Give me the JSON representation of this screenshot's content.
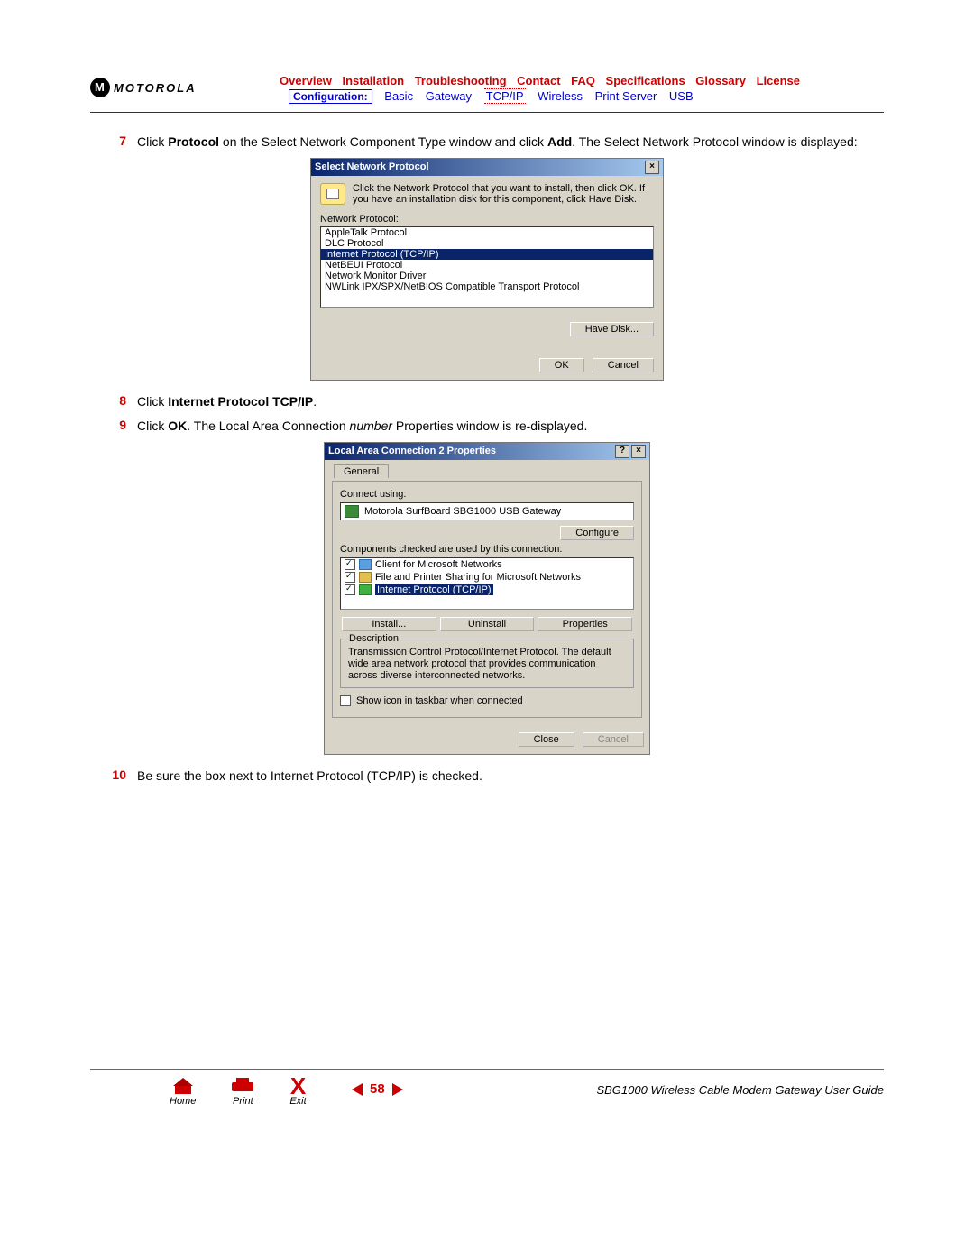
{
  "header": {
    "brand": "MOTOROLA",
    "nav_top": [
      "Overview",
      "Installation",
      "Troubleshooting",
      "Contact",
      "FAQ",
      "Specifications",
      "Glossary",
      "License"
    ],
    "nav_sub_label": "Configuration:",
    "nav_sub": [
      "Basic",
      "Gateway",
      "TCP/IP",
      "Wireless",
      "Print Server",
      "USB"
    ]
  },
  "steps": {
    "s7_num": "7",
    "s7_a": "Click ",
    "s7_b": "Protocol",
    "s7_c": " on the Select Network Component Type window and click ",
    "s7_d": "Add",
    "s7_e": ". The Select Network Protocol window is displayed:",
    "s8_num": "8",
    "s8_a": "Click ",
    "s8_b": "Internet Protocol TCP/IP",
    "s8_c": ".",
    "s9_num": "9",
    "s9_a": "Click ",
    "s9_b": "OK",
    "s9_c": ". The Local Area Connection ",
    "s9_d": "number",
    "s9_e": " Properties window is re-displayed.",
    "s10_num": "10",
    "s10_text": "Be sure the box next to Internet Protocol (TCP/IP) is checked."
  },
  "dialog1": {
    "title": "Select Network Protocol",
    "desc": "Click the Network Protocol that you want to install, then click OK. If you have an installation disk for this component, click Have Disk.",
    "list_label": "Network Protocol:",
    "items": [
      "AppleTalk Protocol",
      "DLC Protocol",
      "Internet Protocol (TCP/IP)",
      "NetBEUI Protocol",
      "Network Monitor Driver",
      "NWLink IPX/SPX/NetBIOS Compatible Transport Protocol"
    ],
    "btn_havedisk": "Have Disk...",
    "btn_ok": "OK",
    "btn_cancel": "Cancel",
    "close": "×"
  },
  "dialog2": {
    "title": "Local Area Connection 2 Properties",
    "tab": "General",
    "connect_label": "Connect using:",
    "adapter": "Motorola SurfBoard SBG1000 USB Gateway",
    "btn_configure": "Configure",
    "components_label": "Components checked are used by this connection:",
    "comp1": "Client for Microsoft Networks",
    "comp2": "File and Printer Sharing for Microsoft Networks",
    "comp3": "Internet Protocol (TCP/IP)",
    "btn_install": "Install...",
    "btn_uninstall": "Uninstall",
    "btn_props": "Properties",
    "desc_legend": "Description",
    "desc_text": "Transmission Control Protocol/Internet Protocol. The default wide area network protocol that provides communication across diverse interconnected networks.",
    "show_icon": "Show icon in taskbar when connected",
    "btn_close": "Close",
    "btn_cancel": "Cancel",
    "help": "?",
    "close": "×"
  },
  "footer": {
    "home": "Home",
    "print": "Print",
    "exit": "Exit",
    "page": "58",
    "guide": "SBG1000 Wireless Cable Modem Gateway User Guide"
  }
}
